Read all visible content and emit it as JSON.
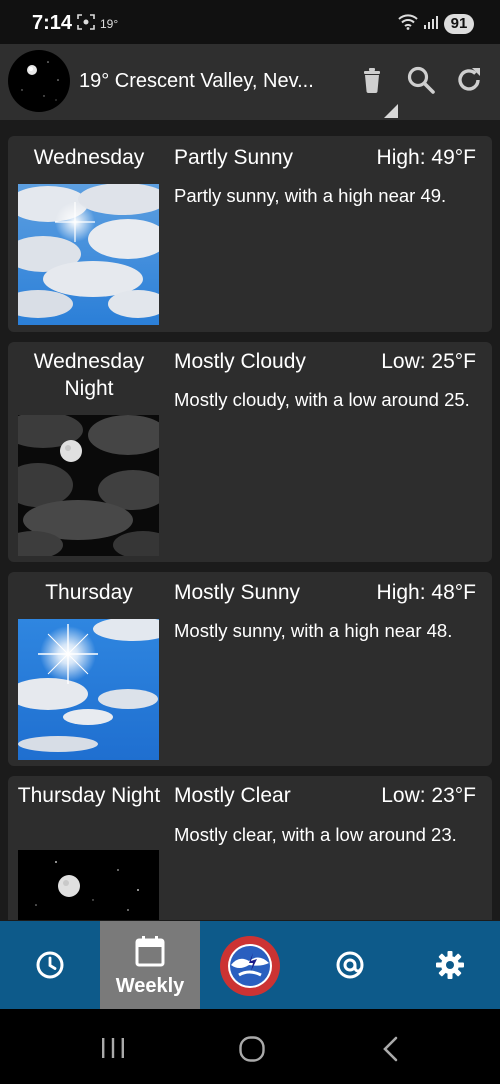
{
  "status_bar": {
    "time": "7:14",
    "temp": "19°",
    "battery": "91"
  },
  "header": {
    "title": "19°  Crescent Valley, Nev...",
    "icons": [
      "delete-icon",
      "search-icon",
      "refresh-icon"
    ]
  },
  "forecast": [
    {
      "day": "Wednesday",
      "condition": "Partly Sunny",
      "temp": "High: 49°F",
      "description": "Partly sunny, with a high near 49.",
      "image": "partly-sunny"
    },
    {
      "day": "Wednesday Night",
      "condition": "Mostly Cloudy",
      "temp": "Low: 25°F",
      "description": "Mostly cloudy, with a low around 25.",
      "image": "mostly-cloudy-night"
    },
    {
      "day": "Thursday",
      "condition": "Mostly Sunny",
      "temp": "High: 48°F",
      "description": "Mostly sunny, with a high near 48.",
      "image": "mostly-sunny"
    },
    {
      "day": "Thursday Night",
      "condition": "Mostly Clear",
      "temp": "Low: 23°F",
      "description": "Mostly clear, with a low around 23.",
      "image": "mostly-clear-night"
    }
  ],
  "bottom_nav": {
    "items": [
      {
        "icon": "clock-icon",
        "label": ""
      },
      {
        "icon": "calendar-icon",
        "label": "Weekly",
        "active": true
      },
      {
        "icon": "nws-logo-icon",
        "label": ""
      },
      {
        "icon": "radar-icon",
        "label": ""
      },
      {
        "icon": "gear-icon",
        "label": ""
      }
    ]
  },
  "colors": {
    "nav_bar": "#0d5a8a",
    "card": "#2d2d2d",
    "header": "#2f2f2f"
  }
}
